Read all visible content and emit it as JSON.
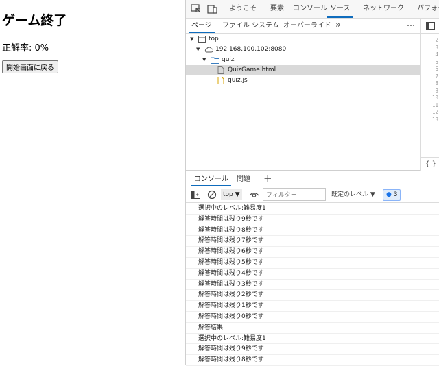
{
  "page": {
    "title": "ゲーム終了",
    "score_text": "正解率: 0%",
    "back_button": "開始画面に戻る"
  },
  "devtools": {
    "top_tabs": [
      "ようこそ",
      "要素",
      "コンソール",
      "ソース",
      "ネットワーク",
      "パフォー"
    ],
    "active_top_tab": "ソース",
    "nav_tabs": [
      "ページ",
      "ファイル システム",
      "オーバーライド"
    ],
    "tree": {
      "top": "top",
      "host": "192.168.100.102:8080",
      "folder": "quiz",
      "files": [
        "QuizGame.html",
        "quiz.js"
      ]
    },
    "line_numbers": [
      "2",
      "3",
      "4",
      "5",
      "6",
      "7",
      "8",
      "9",
      "10",
      "11",
      "12",
      "13"
    ],
    "braces": "{ }",
    "console": {
      "tabs": [
        "コンソール",
        "問題"
      ],
      "context": "top",
      "filter_placeholder": "フィルター",
      "level": "既定のレベル",
      "issue_count": "3",
      "messages": [
        "選択中のレベル:難易度1",
        "解答時間は残り9秒です",
        "解答時間は残り8秒です",
        "解答時間は残り7秒です",
        "解答時間は残り6秒です",
        "解答時間は残り5秒です",
        "解答時間は残り4秒です",
        "解答時間は残り3秒です",
        "解答時間は残り2秒です",
        "解答時間は残り1秒です",
        "解答時間は残り0秒です",
        "解答結果:",
        "選択中のレベル:難易度1",
        "解答時間は残り9秒です",
        "解答時間は残り8秒です"
      ]
    }
  },
  "colors": {
    "accent": "#0f6cbd",
    "selected_row": "#d9d9d9"
  }
}
